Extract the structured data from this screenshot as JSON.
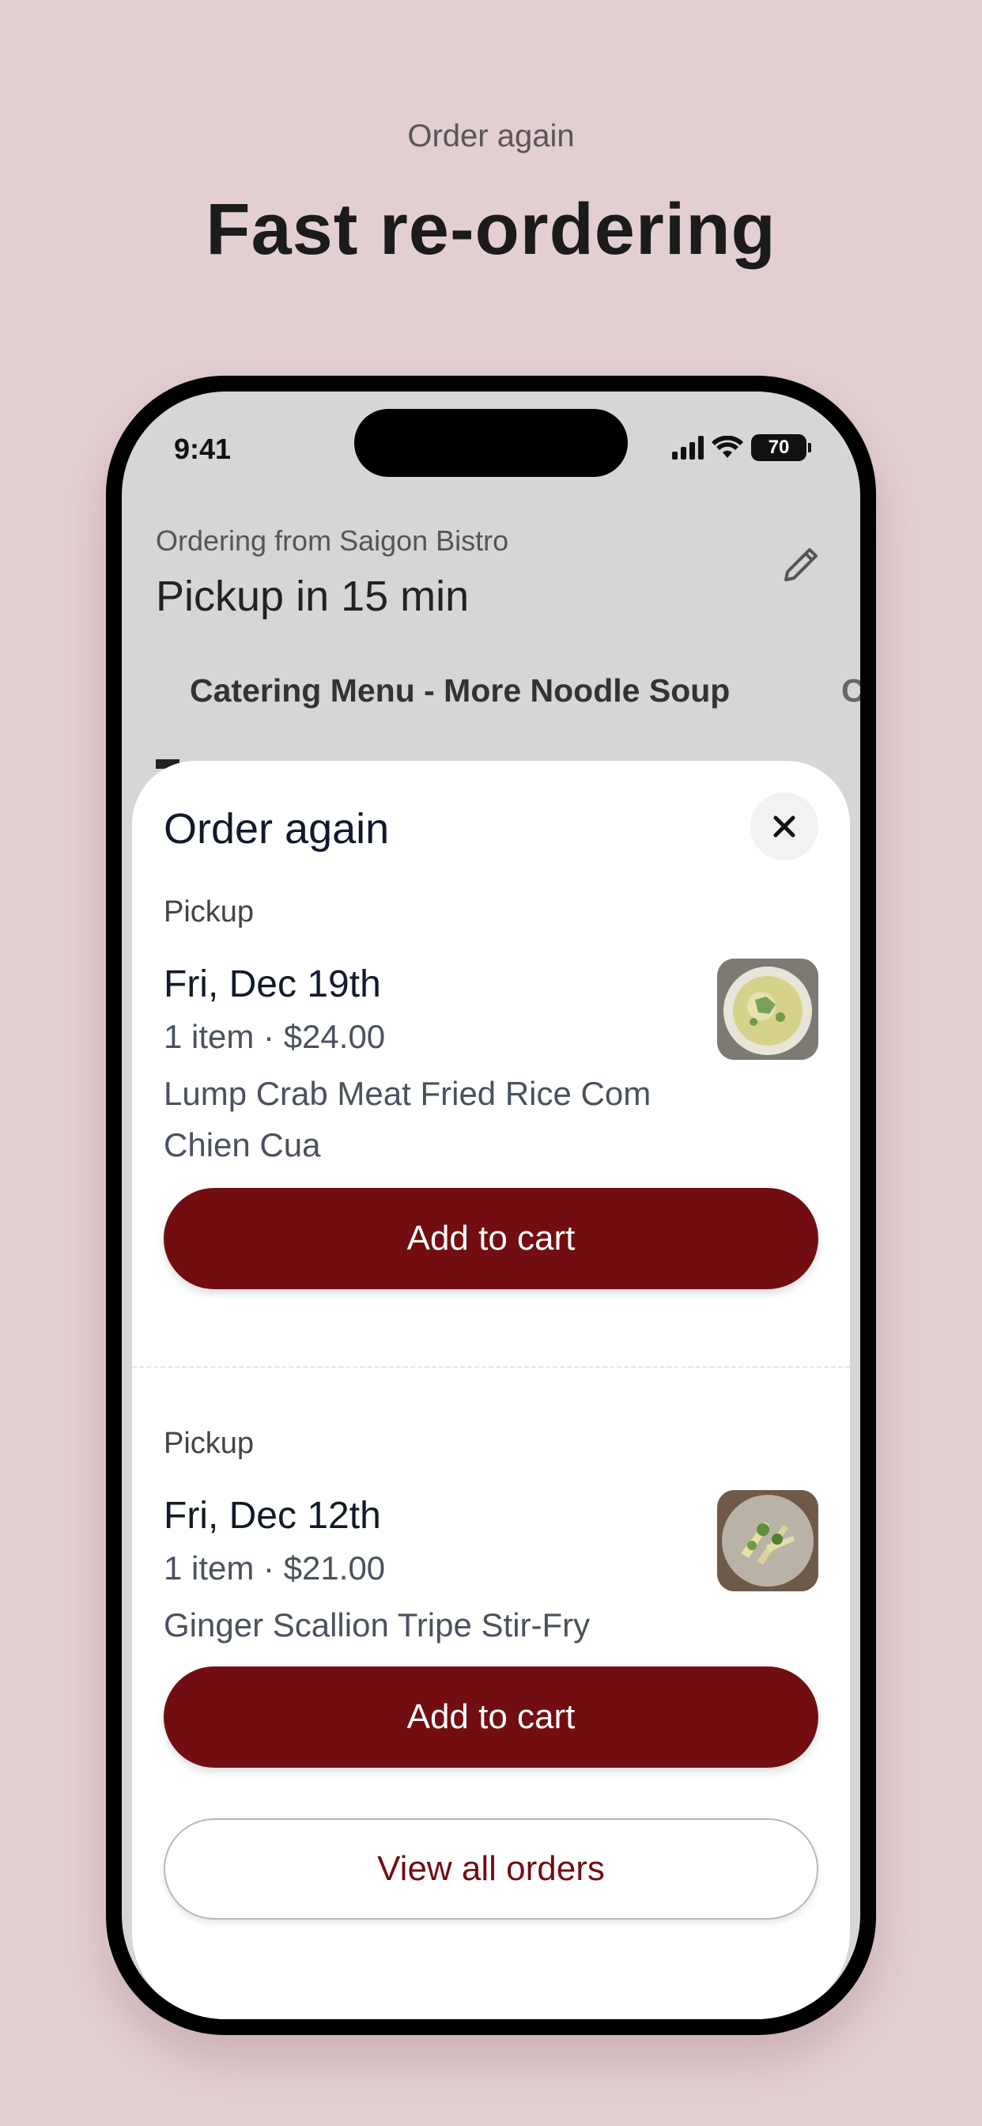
{
  "promo": {
    "eyebrow": "Order again",
    "headline": "Fast re-ordering"
  },
  "status_bar": {
    "time": "9:41",
    "battery": "70"
  },
  "header": {
    "ordering_from": "Ordering from Saigon Bistro",
    "pickup_time": "Pickup in 15 min"
  },
  "tabs": {
    "active": "Catering Menu - More Noodle Soup",
    "next": "C"
  },
  "sheet": {
    "title": "Order again",
    "orders": [
      {
        "kind": "Pickup",
        "date": "Fri, Dec 19th",
        "meta": "1 item · $24.00",
        "description": "Lump Crab Meat Fried Rice Com Chien Cua",
        "add_label": "Add to cart",
        "thumb_icon": "crab-fried-rice-photo"
      },
      {
        "kind": "Pickup",
        "date": "Fri, Dec 12th",
        "meta": "1 item · $21.00",
        "description": "Ginger Scallion Tripe Stir-Fry",
        "add_label": "Add to cart",
        "thumb_icon": "tripe-stir-fry-photo"
      }
    ],
    "view_all_label": "View all orders"
  },
  "colors": {
    "background": "#e3cfd2",
    "primary": "#720e12"
  }
}
